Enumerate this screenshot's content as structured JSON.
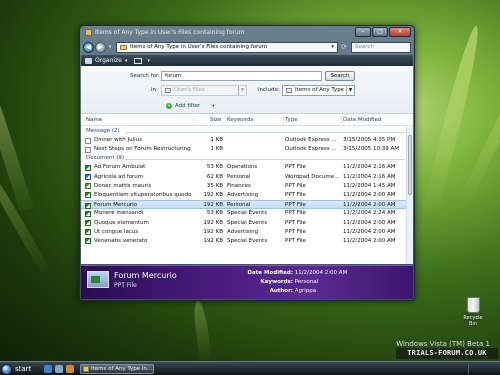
{
  "window": {
    "title": "Items of Any Type in User's Files containing forum"
  },
  "address": {
    "path": "Items of Any Type in User's Files containing forum",
    "search_placeholder": "Search"
  },
  "toolbar": {
    "organize_label": "Organize"
  },
  "search_pane": {
    "search_for_label": "Search for:",
    "search_value": "forum",
    "search_button": "Search",
    "in_label": "in:",
    "in_value": "User's Files",
    "include_label": "include:",
    "include_value": "Items of Any Type",
    "add_filter": "Add filter"
  },
  "columns": {
    "name": "Name",
    "size": "Size",
    "keywords": "Keywords",
    "type": "Type",
    "date": "Date Modified"
  },
  "groups": [
    {
      "label": "Message (2)",
      "rows": [
        {
          "icon": "mail-icon",
          "name": "Dinner with Julius",
          "size": "1 KB",
          "keywords": "",
          "type": "Outlook Express ...",
          "date": "3/15/2005 4:35 PM",
          "selected": false
        },
        {
          "icon": "mail-icon",
          "name": "Next Steps on Forum Restructuring",
          "size": "1 KB",
          "keywords": "",
          "type": "Outlook Express ...",
          "date": "3/15/2005 10:39 AM",
          "selected": false
        }
      ]
    },
    {
      "label": "Document (9)",
      "rows": [
        {
          "icon": "ppt-icon",
          "name": "Ad Forum Ambulat",
          "size": "53 KB",
          "keywords": "Operations",
          "type": "PPT File",
          "date": "11/2/2004 2:16 AM",
          "selected": false
        },
        {
          "icon": "wordpad-icon",
          "name": "Agricola ad forum",
          "size": "62 KB",
          "keywords": "Personal",
          "type": "Wordpad Docume...",
          "date": "11/2/2004 2:16 AM",
          "selected": false
        },
        {
          "icon": "xls-icon",
          "name": "Donec mattis mauris",
          "size": "35 KB",
          "keywords": "Finances",
          "type": "PPT File",
          "date": "11/2/2004 1:45 AM",
          "selected": false
        },
        {
          "icon": "ppt-icon",
          "name": "Eloquentiam vituperatoribus quodo",
          "size": "192 KB",
          "keywords": "Advertising",
          "type": "PPT File",
          "date": "11/2/2004 2:00 AM",
          "selected": false
        },
        {
          "icon": "ppt-icon",
          "name": "Forum Mercurio",
          "size": "192 KB",
          "keywords": "Personal",
          "type": "PPT File",
          "date": "11/2/2004 2:00 AM",
          "selected": true
        },
        {
          "icon": "ppt-icon",
          "name": "Munere mensandi",
          "size": "53 KB",
          "keywords": "Special Events",
          "type": "PPT File",
          "date": "11/2/2004 2:24 AM",
          "selected": false
        },
        {
          "icon": "ppt-icon",
          "name": "Quoque elementum",
          "size": "192 KB",
          "keywords": "Special Events",
          "type": "PPT File",
          "date": "11/2/2004 2:00 AM",
          "selected": false
        },
        {
          "icon": "ppt-icon",
          "name": "Ut congue lacus",
          "size": "192 KB",
          "keywords": "Advertising",
          "type": "PPT File",
          "date": "11/2/2004 2:00 AM",
          "selected": false
        },
        {
          "icon": "ppt-icon",
          "name": "Venenatis venerato",
          "size": "192 KB",
          "keywords": "Special Events",
          "type": "PPT File",
          "date": "11/2/2004 2:00 AM",
          "selected": false
        }
      ]
    }
  ],
  "details": {
    "name": "Forum Mercurio",
    "type": "PPT File",
    "date_label": "Date Modified:",
    "date_value": "11/2/2004 2:00 AM",
    "keywords_label": "Keywords:",
    "keywords_value": "Personal",
    "author_label": "Author:",
    "author_value": "Agrippa"
  },
  "desktop": {
    "recycle_label": "Recycle Bin",
    "watermark": "Windows Vista (TM) Beta 1",
    "site_watermark": "TRIALS-FORUM.CO.UK"
  },
  "taskbar": {
    "start_label": "start",
    "task_label": "Items of Any Type in..."
  },
  "colors": {
    "details_pane": "#4a1c80",
    "selection": "#c2dcf6",
    "toolbar": "#1e2d37"
  }
}
